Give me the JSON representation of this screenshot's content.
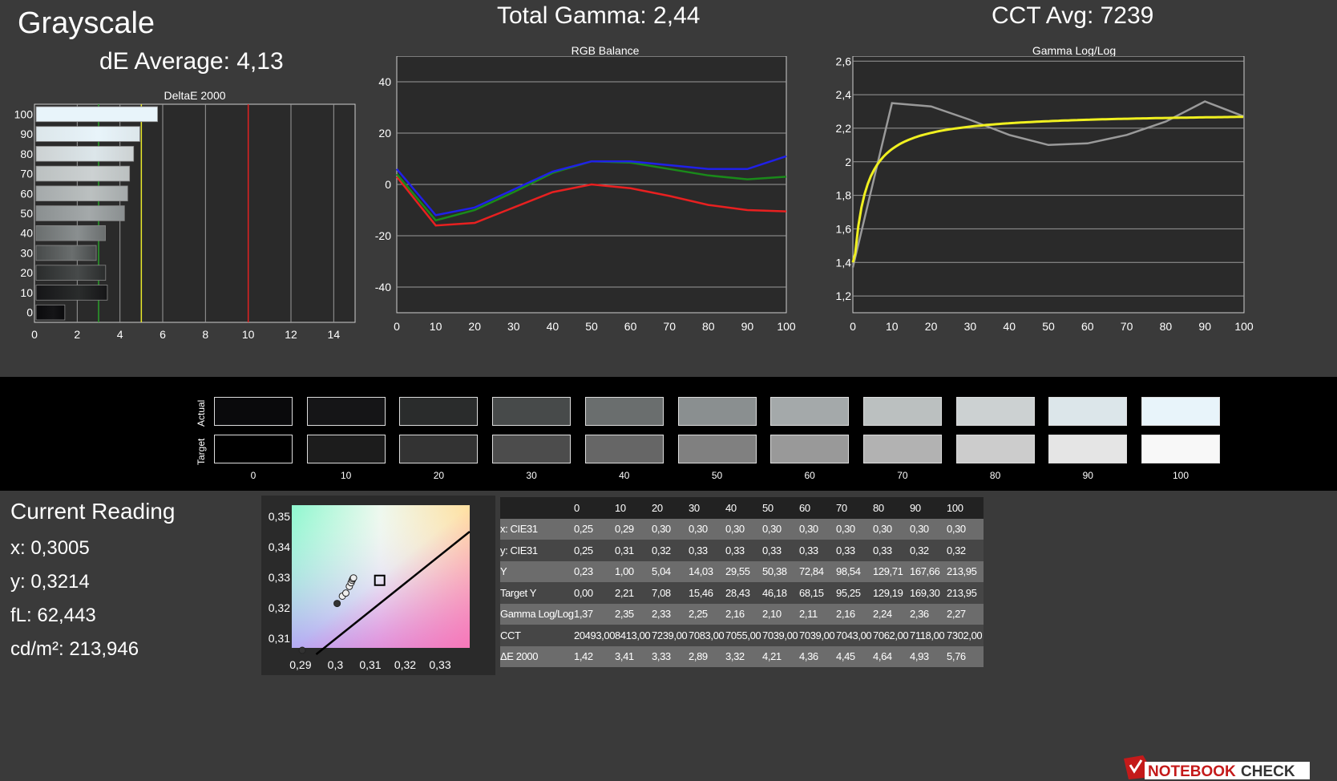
{
  "header": {
    "app_title": "Grayscale",
    "de_average": "dE Average: 4,13",
    "total_gamma": "Total Gamma: 2,44",
    "cct_avg": "CCT Avg: 7239"
  },
  "chart_data": [
    {
      "type": "bar",
      "orientation": "horizontal",
      "title": "DeltaE 2000",
      "categories": [
        "0",
        "10",
        "20",
        "30",
        "40",
        "50",
        "60",
        "70",
        "80",
        "90",
        "100"
      ],
      "values": [
        1.42,
        3.41,
        3.33,
        2.89,
        3.32,
        4.21,
        4.36,
        4.45,
        4.64,
        4.93,
        5.76
      ],
      "xlim": [
        0,
        15
      ],
      "xticks": [
        0,
        2,
        4,
        6,
        8,
        10,
        12,
        14
      ],
      "thresholds": [
        {
          "value": 3,
          "color": "#2aa02a"
        },
        {
          "value": 5,
          "color": "#e8e82a"
        },
        {
          "value": 10,
          "color": "#e02020"
        }
      ],
      "grid": true
    },
    {
      "type": "line",
      "title": "RGB Balance",
      "x": [
        0,
        10,
        20,
        30,
        40,
        50,
        60,
        70,
        80,
        90,
        100
      ],
      "xticks": [
        0,
        10,
        20,
        30,
        40,
        50,
        60,
        70,
        80,
        90,
        100
      ],
      "yticks": [
        -40,
        -20,
        0,
        20,
        40
      ],
      "ylim": [
        -50,
        50
      ],
      "series": [
        {
          "color": "#e82020",
          "values": [
            3,
            -16,
            -15,
            -9,
            -3,
            0,
            -1.5,
            -4.5,
            -8,
            -10,
            -10.5
          ]
        },
        {
          "color": "#1a8a1a",
          "values": [
            4,
            -14,
            -10,
            -3,
            4.5,
            9,
            8.5,
            6,
            3.5,
            2,
            3
          ]
        },
        {
          "color": "#2020e8",
          "values": [
            6,
            -12,
            -9,
            -2,
            5,
            9,
            9,
            7.5,
            6,
            6,
            11
          ]
        }
      ],
      "grid": true
    },
    {
      "type": "line",
      "title": "Gamma Log/Log",
      "x": [
        0,
        10,
        20,
        30,
        40,
        50,
        60,
        70,
        80,
        90,
        100
      ],
      "xticks": [
        0,
        10,
        20,
        30,
        40,
        50,
        60,
        70,
        80,
        90,
        100
      ],
      "yticks": [
        "1,2",
        "1,4",
        "1,6",
        "1,8",
        "2",
        "2,2",
        "2,4",
        "2,6"
      ],
      "ylim": [
        1.1,
        2.63
      ],
      "series": [
        {
          "color": "#9a9a9a",
          "values": [
            1.37,
            2.35,
            2.33,
            2.25,
            2.16,
            2.1,
            2.11,
            2.16,
            2.24,
            2.36,
            2.27
          ]
        },
        {
          "color": "#f0f020",
          "function": "target-gamma",
          "values": [
            1.4,
            2.01,
            2.13,
            2.18,
            2.21,
            2.23,
            2.25,
            2.26,
            2.27,
            2.28,
            2.29
          ]
        }
      ],
      "grid": true
    },
    {
      "type": "scatter",
      "subtitle": "CIE xy chromaticity",
      "xticks": [
        "0,29",
        "0,3",
        "0,31",
        "0,32",
        "0,33"
      ],
      "yticks": [
        "0,31",
        "0,32",
        "0,33",
        "0,34",
        "0,35"
      ],
      "xlim": [
        0.2875,
        0.3385
      ],
      "ylim": [
        0.3068,
        0.3537
      ],
      "points": [
        [
          0.2905,
          0.306
        ],
        [
          0.3005,
          0.3214
        ],
        [
          0.302,
          0.3238
        ],
        [
          0.303,
          0.3248
        ],
        [
          0.304,
          0.327
        ],
        [
          0.3045,
          0.3282
        ],
        [
          0.3048,
          0.329
        ],
        [
          0.305,
          0.3295
        ],
        [
          0.3052,
          0.3298
        ]
      ],
      "target": [
        0.3127,
        0.329
      ]
    }
  ],
  "swatches": {
    "actual_label": "Actual",
    "target_label": "Target",
    "labels": [
      "0",
      "10",
      "20",
      "30",
      "40",
      "50",
      "60",
      "70",
      "80",
      "90",
      "100"
    ],
    "actual_colors": [
      "#0a0a0c",
      "#151517",
      "#2a2c2c",
      "#474a4a",
      "#6a6e6e",
      "#8a8f90",
      "#a4a9aa",
      "#bbc0c0",
      "#ccd1d2",
      "#dce6ea",
      "#e8f4fa"
    ],
    "target_colors": [
      "#000000",
      "#1c1c1c",
      "#333333",
      "#4c4c4c",
      "#666666",
      "#808080",
      "#999999",
      "#b2b2b2",
      "#cccccc",
      "#e5e5e5",
      "#f8f8f8"
    ]
  },
  "current_reading": {
    "title": "Current Reading",
    "x": "x: 0,3005",
    "y": "y: 0,3214",
    "fl": "fL: 62,443",
    "cdm2": "cd/m²: 213,946"
  },
  "table": {
    "columns": [
      "",
      "0",
      "10",
      "20",
      "30",
      "40",
      "50",
      "60",
      "70",
      "80",
      "90",
      "100"
    ],
    "rows": [
      [
        "x: CIE31",
        "0,25",
        "0,29",
        "0,30",
        "0,30",
        "0,30",
        "0,30",
        "0,30",
        "0,30",
        "0,30",
        "0,30",
        "0,30"
      ],
      [
        "y: CIE31",
        "0,25",
        "0,31",
        "0,32",
        "0,33",
        "0,33",
        "0,33",
        "0,33",
        "0,33",
        "0,33",
        "0,32",
        "0,32"
      ],
      [
        "Y",
        "0,23",
        "1,00",
        "5,04",
        "14,03",
        "29,55",
        "50,38",
        "72,84",
        "98,54",
        "129,71",
        "167,66",
        "213,95"
      ],
      [
        "Target Y",
        "0,00",
        "2,21",
        "7,08",
        "15,46",
        "28,43",
        "46,18",
        "68,15",
        "95,25",
        "129,19",
        "169,30",
        "213,95"
      ],
      [
        "Gamma Log/Log",
        "1,37",
        "2,35",
        "2,33",
        "2,25",
        "2,16",
        "2,10",
        "2,11",
        "2,16",
        "2,24",
        "2,36",
        "2,27"
      ],
      [
        "CCT",
        "20493,00",
        "8413,00",
        "7239,00",
        "7083,00",
        "7055,00",
        "7039,00",
        "7039,00",
        "7043,00",
        "7062,00",
        "7118,00",
        "7302,00"
      ],
      [
        "ΔE 2000",
        "1,42",
        "3,41",
        "3,33",
        "2,89",
        "3,32",
        "4,21",
        "4,36",
        "4,45",
        "4,64",
        "4,93",
        "5,76"
      ]
    ]
  },
  "logo": {
    "text_notebook": "NOTEBOOK",
    "text_check": "CHECK"
  }
}
